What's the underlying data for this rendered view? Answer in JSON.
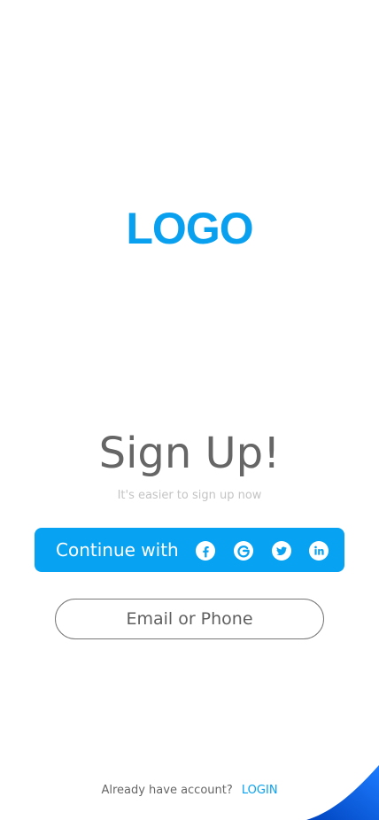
{
  "logo": {
    "text": "LOGO"
  },
  "signup": {
    "title": "Sign Up!",
    "subtitle": "It's easier to sign up now"
  },
  "social": {
    "label": "Continue with",
    "providers": [
      "facebook",
      "google",
      "twitter",
      "linkedin"
    ]
  },
  "email": {
    "label": "Email or Phone"
  },
  "footer": {
    "question": "Already have account?",
    "login_label": "LOGIN"
  },
  "colors": {
    "accent": "#08A2F2",
    "title": "#666666",
    "subtitle": "#C4C4C4",
    "corner_light": "#1D7CFF",
    "corner_dark": "#0044BF"
  },
  "icons": [
    "facebook-icon",
    "google-icon",
    "twitter-icon",
    "linkedin-icon",
    "corner-decoration"
  ]
}
